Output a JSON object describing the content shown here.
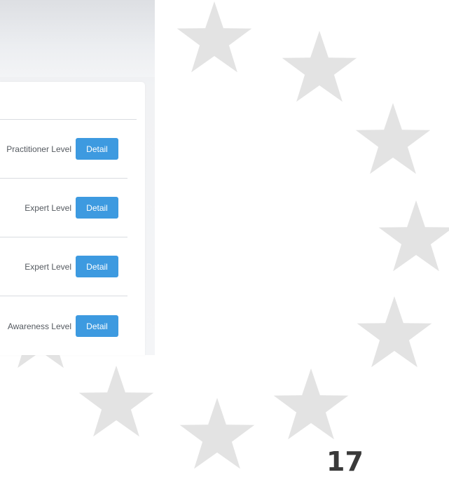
{
  "rows": [
    {
      "level": "Practitioner Level",
      "button": "Detail"
    },
    {
      "level": "Expert Level",
      "button": "Detail"
    },
    {
      "level": "Expert Level",
      "button": "Detail"
    },
    {
      "level": "Awareness Level",
      "button": "Detail"
    }
  ],
  "page_number": "17",
  "colors": {
    "button": "#3d9ae0",
    "star": "#e3e3e3",
    "page_number": "#3a3a3a"
  }
}
